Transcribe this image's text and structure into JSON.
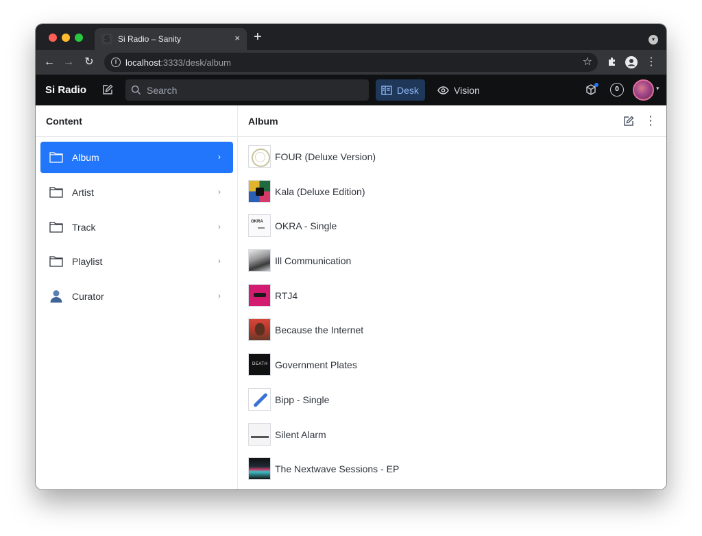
{
  "browser": {
    "tab_title": "Si Radio – Sanity",
    "tab_favicon": "S",
    "tab_close": "×",
    "new_tab": "+",
    "url_host": "localhost",
    "url_rest": ":3333/desk/album"
  },
  "header": {
    "brand": "Si Radio",
    "search_placeholder": "Search",
    "tools": [
      {
        "label": "Desk",
        "active": true
      },
      {
        "label": "Vision",
        "active": false
      }
    ],
    "presence_count": "0"
  },
  "sidebar": {
    "title": "Content",
    "items": [
      {
        "label": "Album",
        "icon": "folder-icon",
        "active": true
      },
      {
        "label": "Artist",
        "icon": "folder-icon",
        "active": false
      },
      {
        "label": "Track",
        "icon": "folder-icon",
        "active": false
      },
      {
        "label": "Playlist",
        "icon": "folder-icon",
        "active": false
      },
      {
        "label": "Curator",
        "icon": "user-icon",
        "active": false
      }
    ]
  },
  "main": {
    "title": "Album",
    "albums": [
      {
        "title": "FOUR (Deluxe Version)"
      },
      {
        "title": "Kala (Deluxe Edition)"
      },
      {
        "title": "OKRA - Single"
      },
      {
        "title": "Ill Communication"
      },
      {
        "title": "RTJ4"
      },
      {
        "title": "Because the Internet"
      },
      {
        "title": "Government Plates"
      },
      {
        "title": "Bipp - Single"
      },
      {
        "title": "Silent Alarm"
      },
      {
        "title": "The Nextwave Sessions - EP"
      }
    ]
  },
  "colors": {
    "accent": "#2276fc",
    "appbar_bg": "#101112",
    "desk_active_bg": "#1f3859"
  }
}
